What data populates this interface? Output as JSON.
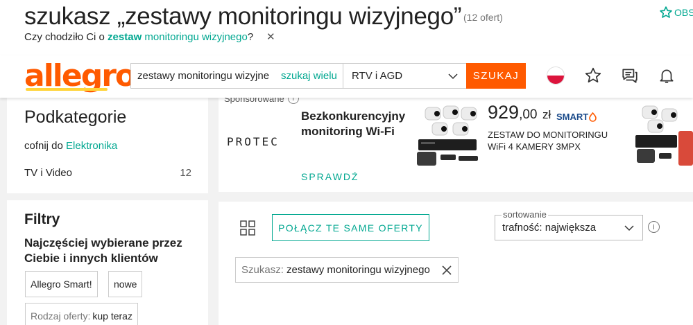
{
  "heading": {
    "prefix": "szukasz „zestawy monitoringu wizyjnego”",
    "count": "(12 ofert)",
    "observe": "OBS"
  },
  "did_you_mean": {
    "prefix": "Czy chodziło Ci o ",
    "bold": "zestaw",
    "rest": " monitoringu wizyjnego",
    "suffix": "?",
    "close": "✕"
  },
  "header": {
    "logo": "allegro",
    "search_value": "zestawy monitoringu wizyjne",
    "search_many": "szukaj wielu",
    "category": "RTV i AGD",
    "search_button": "SZUKAJ",
    "colors": {
      "accent": "#ff5a00",
      "link": "#00a790",
      "logo_bar": "#ffd43b"
    }
  },
  "subcategories": {
    "title": "Podkategorie",
    "back_prefix": "cofnij do ",
    "back_link": "Elektronika",
    "items": [
      {
        "label": "TV i Video",
        "count": "12"
      }
    ]
  },
  "filters": {
    "title": "Filtry",
    "subtitle": "Najczęściej wybierane przez Ciebie i innych klientów",
    "chips": [
      "Allegro Smart!",
      "nowe"
    ],
    "offer_type_label": "Rodzaj oferty:",
    "offer_type_value": "kup teraz"
  },
  "ad": {
    "sponsored": "Sponsorowane",
    "info": "i",
    "brand": "PROTEC",
    "headline": "Bezkonkurencyjny monitoring Wi-Fi",
    "cta": "SPRAWDŹ",
    "price_int": "929",
    "price_dec": ",00",
    "currency": "zł",
    "smart": "SMART",
    "product": "ZESTAW DO MONITORINGU WiFi 4 KAMERY 3MPX"
  },
  "listing": {
    "merge_button": "POŁĄCZ TE SAME OFERTY",
    "sort_label": "sortowanie",
    "sort_value": "trafność: największa",
    "info": "i",
    "query_label": "Szukasz:",
    "query_value": " zestawy monitoringu wizyjnego"
  }
}
